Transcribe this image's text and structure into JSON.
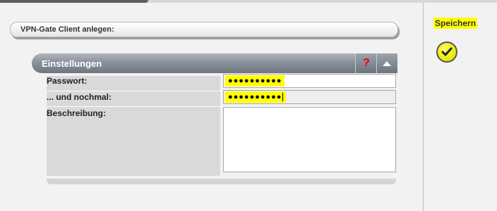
{
  "page": {
    "title": "VPN-Gate Client anlegen:"
  },
  "settings": {
    "title": "Einstellungen",
    "help_symbol": "?",
    "fields": {
      "password_label": "Passwort:",
      "password_value": "●●●●●●●●●●",
      "password_confirm_label": "... und nochmal:",
      "password_confirm_value": "●●●●●●●●●●",
      "description_label": "Beschreibung:",
      "description_value": ""
    }
  },
  "sidebar": {
    "save_label": "Speichern"
  },
  "icons": {
    "help": "help-icon",
    "collapse": "collapse-up-icon",
    "save": "checkmark-icon"
  },
  "colors": {
    "highlight": "#ffff00",
    "header_gray": "#8b919b",
    "help_red": "#e00000"
  }
}
